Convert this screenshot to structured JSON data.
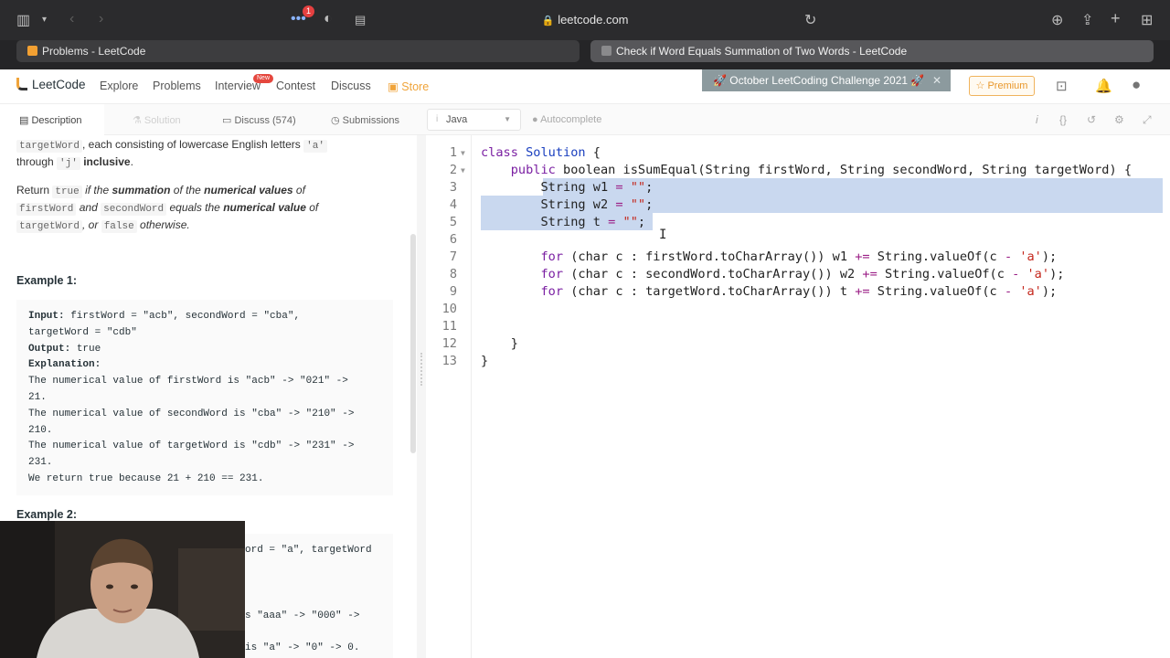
{
  "browser": {
    "url": "leetcode.com",
    "extension_badge": "1",
    "tabs": [
      {
        "label": "Problems - LeetCode"
      },
      {
        "label": "Check if Word Equals Summation of Two Words - LeetCode"
      }
    ]
  },
  "nav": {
    "logo": "LeetCode",
    "items": [
      "Explore",
      "Problems",
      "Interview",
      "Contest",
      "Discuss",
      "Store"
    ],
    "new_badge": "New",
    "challenge_banner": "🚀 October LeetCoding Challenge 2021 🚀",
    "premium": "Premium"
  },
  "subbar": {
    "description": "Description",
    "solution": "Solution",
    "discuss": "Discuss (574)",
    "submissions": "Submissions",
    "language": "Java",
    "autocomplete": "Autocomplete"
  },
  "description": {
    "line1_code": "targetWord",
    "line1_rest": ", each consisting of lowercase English letters ",
    "line1_a": "'a'",
    "line2_pre": "through ",
    "line2_j": "'j'",
    "line2_inclusive": "inclusive",
    "line2_dot": ".",
    "ret_1": "Return ",
    "ret_true": "true",
    "ret_2": " if the ",
    "ret_summation": "summation",
    "ret_3": " of the ",
    "ret_numvals": "numerical values",
    "ret_4": " of",
    "ret_first": "firstWord",
    "ret_5": " and ",
    "ret_second": "secondWord",
    "ret_6": " equals the ",
    "ret_numval": "numerical value",
    "ret_7": " of",
    "ret_target": "targetWord",
    "ret_8": ", or ",
    "ret_false": "false",
    "ret_9": " otherwise.",
    "example1_title": "Example 1:",
    "ex1_input_label": "Input:",
    "ex1_input": " firstWord = \"acb\", secondWord = \"cba\",",
    "ex1_input2": "targetWord = \"cdb\"",
    "ex1_output_label": "Output:",
    "ex1_output": " true",
    "ex1_expl_label": "Explanation:",
    "ex1_lines": [
      "The numerical value of firstWord is \"acb\" -> \"021\" ->",
      "21.",
      "The numerical value of secondWord is \"cba\" -> \"210\" ->",
      "210.",
      "The numerical value of targetWord is \"cdb\" -> \"231\" ->",
      "231.",
      "We return true because 21 + 210 == 231."
    ],
    "example2_title": "Example 2:",
    "ex2_partial": [
      "ord = \"a\", targetWord",
      "s \"aaa\" -> \"000\" ->",
      "is \"a\" -> \"0\" -> 0."
    ]
  },
  "editor": {
    "line_numbers": [
      "1",
      "2",
      "3",
      "4",
      "5",
      "6",
      "7",
      "8",
      "9",
      "10",
      "11",
      "12",
      "13"
    ]
  },
  "colors": {
    "accent": "#f0a43a",
    "selection": "#c9d8ef",
    "keyword": "#7a1fa2",
    "class_name": "#1a3fbf",
    "string": "#c4261b"
  }
}
